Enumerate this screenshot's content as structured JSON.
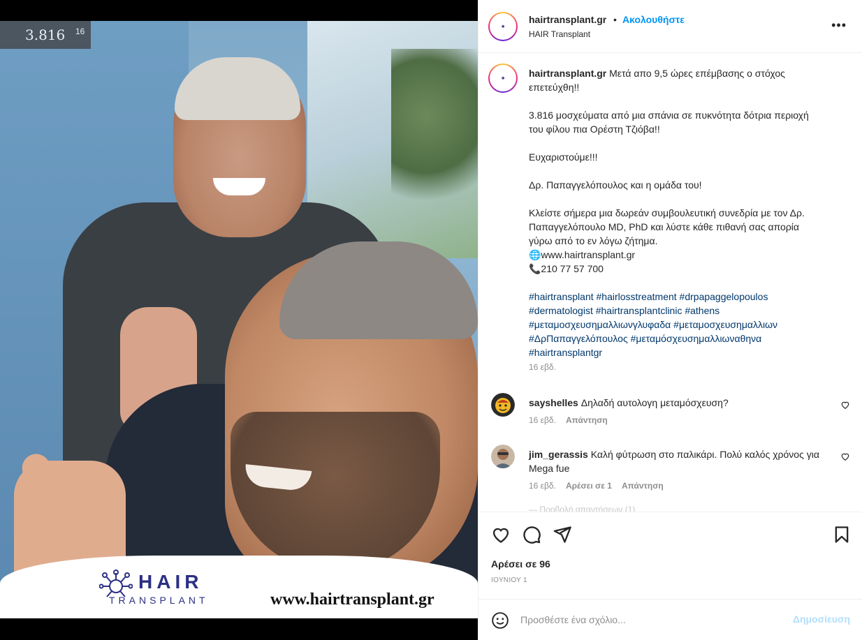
{
  "photo": {
    "sign_text": "3.816",
    "sign_small": "16",
    "banner_logo_word": "HAIR",
    "banner_logo_sub": "TRANSPLANT",
    "banner_url": "www.hairtransplant.gr"
  },
  "header": {
    "username": "hairtransplant.gr",
    "separator": "•",
    "follow_label": "Ακολουθήστε",
    "subtitle": "HAIR Transplant",
    "more_label": "•••"
  },
  "caption": {
    "username": "hairtransplant.gr",
    "text": " Μετά απο 9,5 ώρες επέμβασης ο στόχος επετεύχθη!!\n\n3.816 μοσχεύματα από μια σπάνια σε πυκνότητα δότρια περιοχή του φίλου πια Ορέστη Τζιόβα!!\n\nΕυχαριστούμε!!!\n\nΔρ. Παπαγγελόπουλος και η ομάδα του!\n\nΚλείστε σήμερα μια δωρεάν συμβουλευτική συνεδρία με τον Δρ. Παπαγγελόπουλο MD, PhD και λύστε κάθε πιθανή σας απορία γύρω από το εν λόγω ζήτημα.\n🌐www.hairtransplant.gr\n📞210 77 57 700\n\n",
    "hashtags": "#hairtransplant #hairlosstreatment #drpapaggelopoulos #dermatologist #hairtransplantclinic #athens #μεταμοσχευσημαλλιωνγλυφαδα #μεταμοσχευσημαλλιων #ΔρΠαπαγγελόπουλος #μεταμόσχευσημαλλιωναθηνα #hairtransplantgr",
    "time": "16 εβδ."
  },
  "comments": [
    {
      "username": "sayshelles",
      "text": " Δηλαδή αυτολογη μεταμόσχευση?",
      "time": "16 εβδ.",
      "reply": "Απάντηση"
    },
    {
      "username": "jim_gerassis",
      "text": " Καλή φύτρωση στο παλικάρι. Πολύ καλός χρόνος για Mega fue",
      "time": "16 εβδ.",
      "likes": "Αρέσει σε 1",
      "reply": "Απάντηση"
    }
  ],
  "faded_text": "— Προβολή απαντήσεων (1)",
  "actions": {
    "likes": "Αρέσει σε 96",
    "date": "ΙΟΥΝΙΟΥ 1"
  },
  "add_comment": {
    "placeholder": "Προσθέστε ένα σχόλιο...",
    "post_label": "Δημοσίευση"
  },
  "colors": {
    "accent": "#0095f6",
    "hashtag": "#00376b",
    "muted": "#8e8e8e",
    "post_disabled": "#b2dffc",
    "brand": "#2b2f84"
  }
}
